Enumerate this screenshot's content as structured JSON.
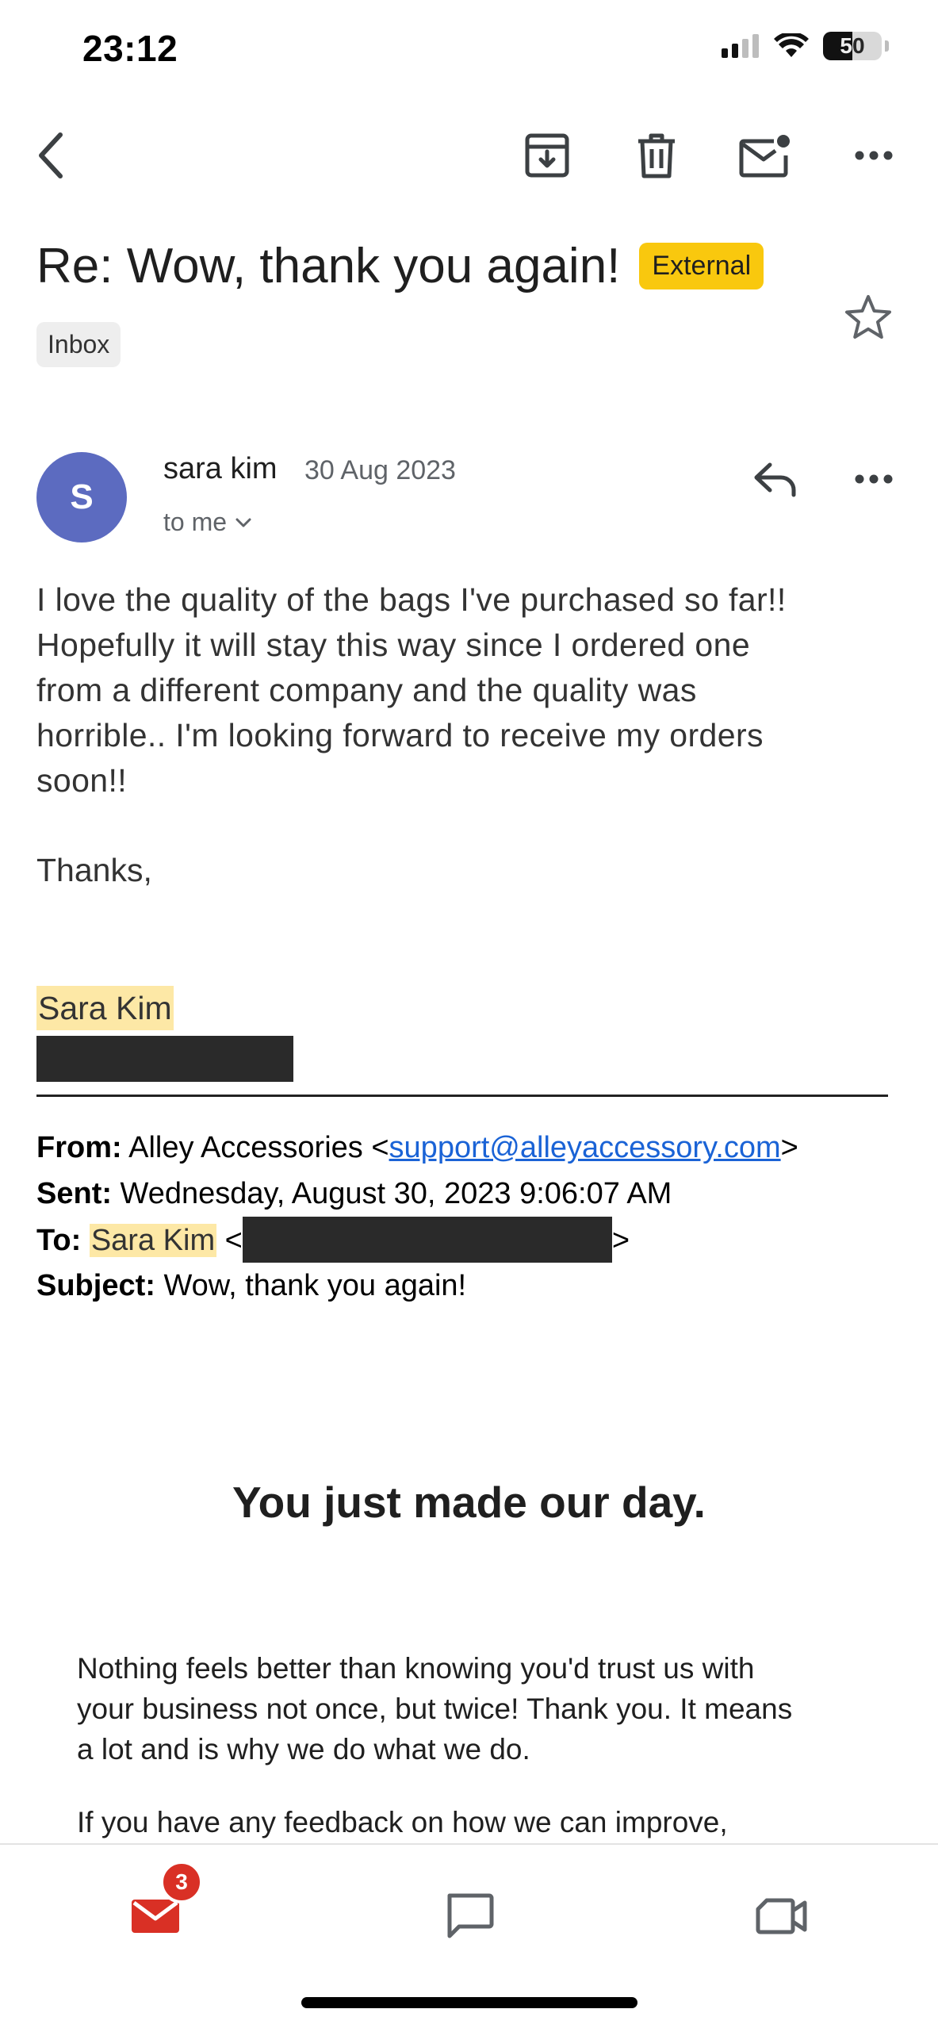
{
  "status_bar": {
    "time": "23:12",
    "battery": "50"
  },
  "toolbar": {
    "back_icon": "chevron-left-icon",
    "archive_icon": "archive-icon",
    "delete_icon": "trash-icon",
    "mark_unread_icon": "mail-unread-icon",
    "more_icon": "more-horizontal-icon"
  },
  "email": {
    "subject": "Re: Wow, thank you again!",
    "external_badge": "External",
    "label": "Inbox",
    "sender": {
      "initial": "S",
      "name": "sara kim",
      "date": "30 Aug 2023",
      "to": "to me"
    },
    "body_lines": [
      "I love the quality of the bags I've purchased so far!!",
      "Hopefully it will stay this way since I ordered one",
      "from a different company and the quality was",
      "horrible.. I'm looking forward to receive my orders",
      "soon!!"
    ],
    "closing": "Thanks,",
    "signature_name": "Sara Kim",
    "quoted": {
      "from_label": "From:",
      "from_name": " Alley Accessories <",
      "from_email": "support@alleyaccessory.com",
      "from_end": ">",
      "sent_label": "Sent:",
      "sent_value": " Wednesday, August 30, 2023 9:06:07 AM",
      "to_label": "To:",
      "to_name": "Sara Kim",
      "to_open": " <",
      "to_close": ">",
      "subject_label": "Subject:",
      "subject_value": " Wow, thank you again!",
      "headline": "You just made our day.",
      "paragraph1_lines": [
        "Nothing feels better than knowing you'd trust us with",
        "your business not once, but twice! Thank you. It means",
        "a lot and is why we do what we do."
      ],
      "paragraph2_line": "If you have any feedback on how we can improve,"
    }
  },
  "bottom_nav": {
    "mail_badge": "3",
    "items": [
      "mail-icon",
      "chat-icon",
      "meet-video-icon"
    ]
  },
  "colors": {
    "accent_blue": "#1a63d6",
    "external_badge": "#f9c80e",
    "avatar": "#5c6bc0",
    "mail_red": "#d93025",
    "highlight": "#fde8a6"
  }
}
